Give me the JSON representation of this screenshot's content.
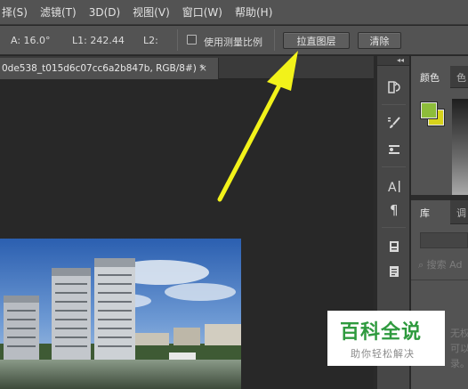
{
  "menu": [
    "择(S)",
    "滤镜(T)",
    "3D(D)",
    "视图(V)",
    "窗口(W)",
    "帮助(H)"
  ],
  "options": {
    "angle": "A: 16.0°",
    "l1": "L1: 242.44",
    "l2": "L2:",
    "use_scale_label": "使用测量比例",
    "straighten_label": "拉直图层",
    "clear_label": "清除"
  },
  "document": {
    "tab_title": "0de538_t015d6c07cc6a2b847b, RGB/8#) *",
    "close_glyph": "×"
  },
  "panel_strip": {
    "collapse_glyph": "◂◂"
  },
  "color_panel": {
    "tab_active": "颜色",
    "tab_inactive": "色",
    "foreground": "#8dbd3a",
    "background": "#d7d21b"
  },
  "library_panel": {
    "tab_active": "库",
    "tab_inactive": "调",
    "search_placeholder": "搜索 Ad",
    "faded_lines": [
      "无权访",
      "可以承",
      "录。左"
    ]
  },
  "watermark": {
    "title": "百科全说",
    "subtitle": "助你轻松解决"
  },
  "colors": {
    "arrow": "#f2f21a",
    "watermark_green": "#2e9a3e"
  }
}
